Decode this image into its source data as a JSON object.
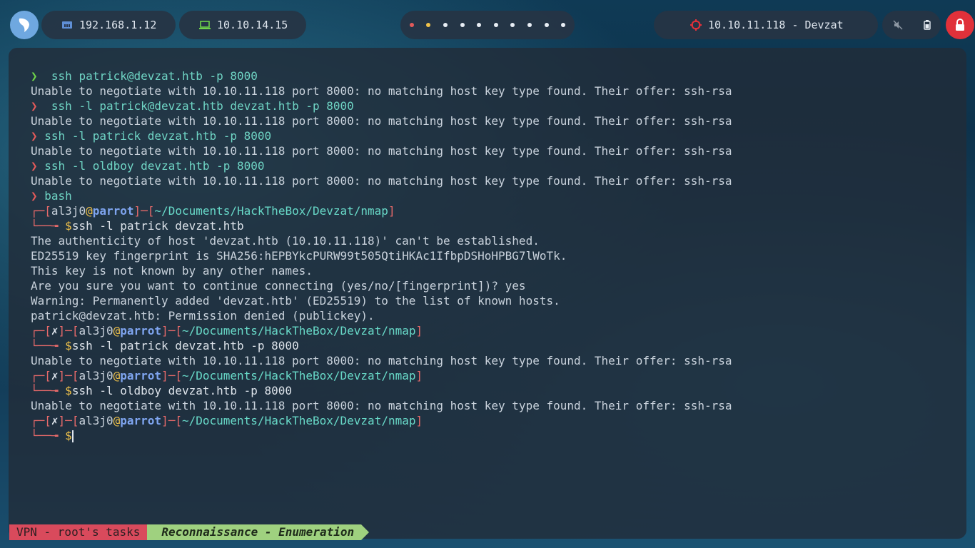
{
  "topbar": {
    "ip_local": "192.168.1.12",
    "ip_vpn": "10.10.14.15",
    "target": "10.10.11.118 - Devzat",
    "workspace_count": 10
  },
  "terminal": {
    "lines": [
      {
        "kind": "cmd",
        "mark": "❯",
        "mark_color": "green",
        "cmd": " ssh patrick@devzat.htb -p 8000"
      },
      {
        "kind": "out",
        "text": "Unable to negotiate with 10.10.11.118 port 8000: no matching host key type found. Their offer: ssh-rsa"
      },
      {
        "kind": "cmd",
        "mark": "❯",
        "mark_color": "red",
        "cmd": " ssh -l patrick@devzat.htb devzat.htb -p 8000"
      },
      {
        "kind": "out",
        "text": "Unable to negotiate with 10.10.11.118 port 8000: no matching host key type found. Their offer: ssh-rsa"
      },
      {
        "kind": "cmd",
        "mark": "❯",
        "mark_color": "red",
        "cmd": "ssh -l patrick devzat.htb -p 8000"
      },
      {
        "kind": "out",
        "text": "Unable to negotiate with 10.10.11.118 port 8000: no matching host key type found. Their offer: ssh-rsa"
      },
      {
        "kind": "cmd",
        "mark": "❯",
        "mark_color": "red",
        "cmd": "ssh -l oldboy devzat.htb -p 8000"
      },
      {
        "kind": "out",
        "text": "Unable to negotiate with 10.10.11.118 port 8000: no matching host key type found. Their offer: ssh-rsa"
      },
      {
        "kind": "cmd",
        "mark": "❯",
        "mark_color": "red",
        "cmd": "bash"
      },
      {
        "kind": "prompt",
        "status": "",
        "user": "al3j0",
        "host": "parrot",
        "path": "~/Documents/HackTheBox/Devzat/nmap"
      },
      {
        "kind": "pcmd",
        "cmd": "ssh -l patrick devzat.htb"
      },
      {
        "kind": "out",
        "text": "The authenticity of host 'devzat.htb (10.10.11.118)' can't be established."
      },
      {
        "kind": "out",
        "text": "ED25519 key fingerprint is SHA256:hEPBYkcPURW99t505QtiHKAc1IfbpDSHoHPBG7lWoTk."
      },
      {
        "kind": "out",
        "text": "This key is not known by any other names."
      },
      {
        "kind": "out",
        "text": "Are you sure you want to continue connecting (yes/no/[fingerprint])? yes"
      },
      {
        "kind": "out",
        "text": "Warning: Permanently added 'devzat.htb' (ED25519) to the list of known hosts."
      },
      {
        "kind": "out",
        "text": "patrick@devzat.htb: Permission denied (publickey)."
      },
      {
        "kind": "prompt",
        "status": "✗",
        "user": "al3j0",
        "host": "parrot",
        "path": "~/Documents/HackTheBox/Devzat/nmap"
      },
      {
        "kind": "pcmd",
        "cmd": "ssh -l patrick devzat.htb -p 8000"
      },
      {
        "kind": "out",
        "text": "Unable to negotiate with 10.10.11.118 port 8000: no matching host key type found. Their offer: ssh-rsa"
      },
      {
        "kind": "prompt",
        "status": "✗",
        "user": "al3j0",
        "host": "parrot",
        "path": "~/Documents/HackTheBox/Devzat/nmap"
      },
      {
        "kind": "pcmd",
        "cmd": "ssh -l oldboy devzat.htb -p 8000"
      },
      {
        "kind": "out",
        "text": "Unable to negotiate with 10.10.11.118 port 8000: no matching host key type found. Their offer: ssh-rsa"
      },
      {
        "kind": "prompt",
        "status": "✗",
        "user": "al3j0",
        "host": "parrot",
        "path": "~/Documents/HackTheBox/Devzat/nmap"
      },
      {
        "kind": "pcmd",
        "cmd": "",
        "cursor": true
      }
    ]
  },
  "statusbar": {
    "vpn_label": "VPN - root's tasks",
    "task_label": "Reconnaissance - Enumeration"
  },
  "colors": {
    "lock_button": "#e0313a",
    "prompt_frame": "#e86a6a",
    "host": "#7fa5f0",
    "path": "#68d9c8"
  }
}
